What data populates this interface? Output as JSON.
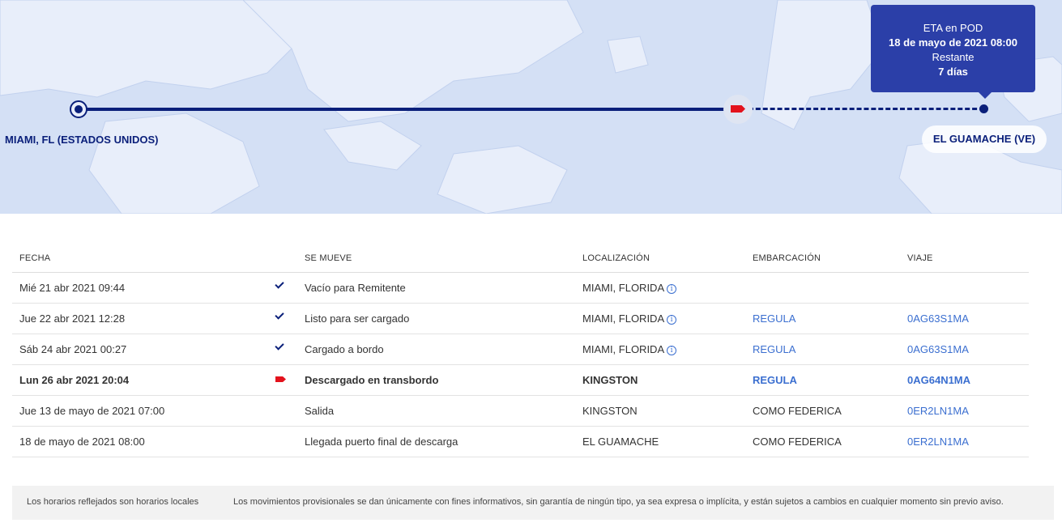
{
  "map": {
    "origin_label": "MIAMI, FL (ESTADOS UNIDOS)",
    "destination_label": "EL GUAMACHE (VE)",
    "eta": {
      "title": "ETA en POD",
      "datetime": "18 de mayo de 2021 08:00",
      "remaining_label": "Restante",
      "remaining_value": "7 días"
    },
    "progress": 0.72
  },
  "table": {
    "headers": {
      "date": "FECHA",
      "move": "SE MUEVE",
      "location": "LOCALIZACIÓN",
      "vessel": "EMBARCACIÓN",
      "voyage": "VIAJE"
    },
    "rows": [
      {
        "date": "Mié 21 abr 2021 09:44",
        "status_icon": "check-icon",
        "move": "Vacío para Remitente",
        "location": "MIAMI, FLORIDA",
        "vessel": "",
        "voyage": ""
      },
      {
        "date": "Jue 22 abr 2021 12:28",
        "status_icon": "check-icon",
        "move": "Listo para ser cargado",
        "location": "MIAMI, FLORIDA",
        "vessel": "REGULA",
        "voyage": "0AG63S1MA"
      },
      {
        "date": "Sáb 24 abr 2021 00:27",
        "status_icon": "check-icon",
        "move": "Cargado a bordo",
        "location": "MIAMI, FLORIDA",
        "vessel": "REGULA",
        "voyage": "0AG63S1MA"
      },
      {
        "date": "Lun 26 abr 2021 20:04",
        "status_icon": "ship-icon",
        "move": "Descargado en transbordo",
        "location": "KINGSTON",
        "vessel": "REGULA",
        "voyage": "0AG64N1MA"
      },
      {
        "date": "Jue 13 de mayo de 2021 07:00",
        "status_icon": "",
        "move": "Salida",
        "location": "KINGSTON",
        "vessel": "COMO FEDERICA",
        "voyage": "0ER2LN1MA"
      },
      {
        "date": "18 de mayo de 2021 08:00",
        "status_icon": "",
        "move": "Llegada puerto final de descarga",
        "location": "EL GUAMACHE",
        "vessel": "COMO FEDERICA",
        "voyage": "0ER2LN1MA"
      }
    ]
  },
  "footer": {
    "local_times_note": "Los horarios reflejados son horarios locales",
    "disclaimer": "Los movimientos provisionales se dan únicamente con fines informativos, sin garantía de ningún tipo, ya sea expresa o implícita, y están sujetos a cambios en cualquier momento sin previo aviso."
  },
  "colors": {
    "route": "#0a1f7a",
    "eta_box": "#2b3fa8",
    "current_marker": "#e3121c",
    "link": "#3b6fd0"
  }
}
